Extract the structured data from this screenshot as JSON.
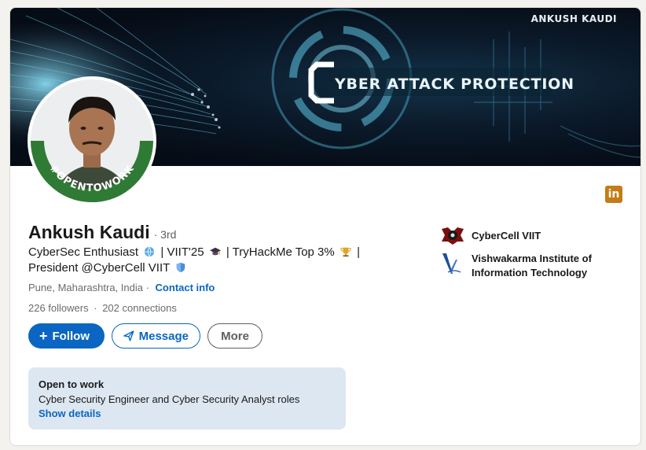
{
  "banner": {
    "watermark": "ANKUSH KAUDI",
    "headline": "YBER ATTACK PROTECTION"
  },
  "avatar": {
    "badge_text": "#OPENTOWORK"
  },
  "profile": {
    "name": "Ankush Kaudi",
    "degree": "· 3rd",
    "headline_part1": "CyberSec Enthusiast",
    "headline_part2": "| VIIT'25",
    "headline_part3": "| TryHackMe Top 3%",
    "headline_part4": "| President @CyberCell VIIT",
    "location": "Pune, Maharashtra, India ·",
    "contact_label": "Contact info",
    "followers": "226 followers",
    "separator": "·",
    "connections": "202 connections"
  },
  "actions": {
    "follow_label": "Follow",
    "message_label": "Message",
    "more_label": "More"
  },
  "open_to_work": {
    "title": "Open to work",
    "roles": "Cyber Security Engineer and Cyber Security Analyst roles",
    "details_label": "Show details"
  },
  "organizations": [
    {
      "name": "CyberCell VIIT"
    },
    {
      "name": "Vishwakarma Institute of Information Technology"
    }
  ],
  "icons": {
    "linkedin": "linkedin-icon",
    "globe": "globe-icon",
    "grad_cap": "graduation-cap-icon",
    "trophy": "trophy-icon",
    "shield": "shield-icon",
    "plus": "plus-icon",
    "send": "send-icon"
  },
  "colors": {
    "accent": "#0a66c2",
    "open_to_work_bg": "#dde7f1",
    "otw_ring": "#2f7a34",
    "linkedin_badge": "#c37d16"
  }
}
